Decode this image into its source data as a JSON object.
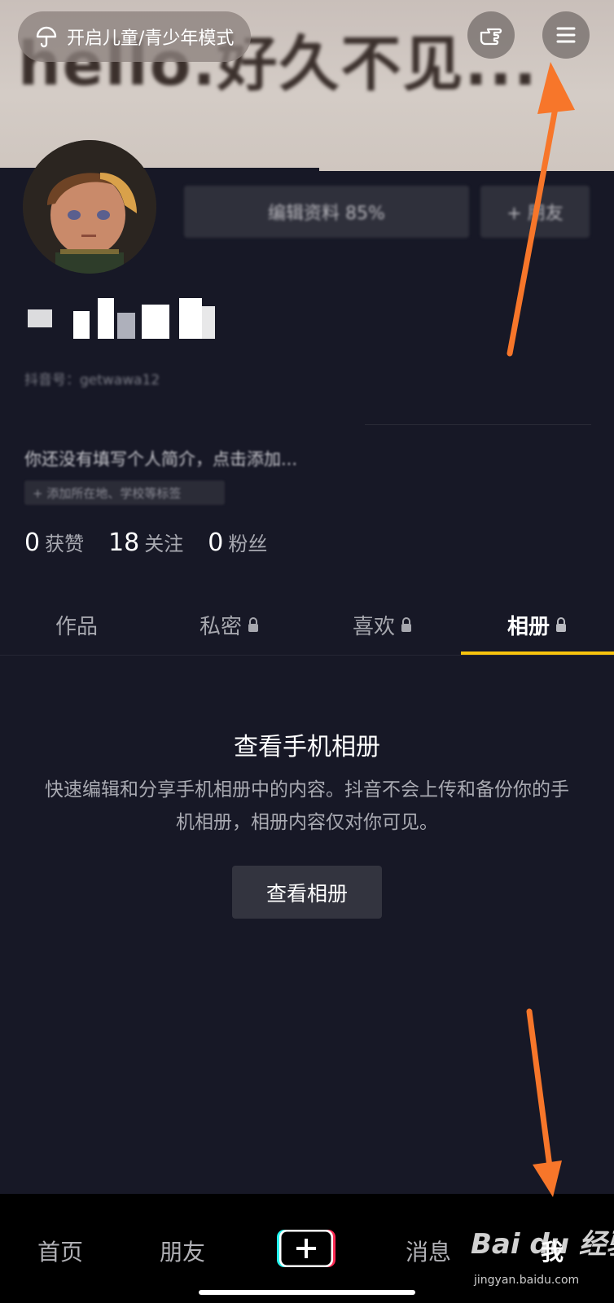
{
  "banner": {
    "background_text": "hello.好久不见...",
    "kids_mode_label": "开启儿童/青少年模式"
  },
  "profile": {
    "edit_profile_label": "编辑资料 85%",
    "add_friend_label": "+ 朋友",
    "douyin_id": "抖音号：getwawa12",
    "bio_placeholder": "你还没有填写个人简介，点击添加...",
    "tag_hint": "+ 添加所在地、学校等标签"
  },
  "stats": [
    {
      "num": "0",
      "label": "获赞"
    },
    {
      "num": "18",
      "label": "关注"
    },
    {
      "num": "0",
      "label": "粉丝"
    }
  ],
  "tabs": [
    {
      "label": "作品",
      "locked": false
    },
    {
      "label": "私密",
      "locked": true
    },
    {
      "label": "喜欢",
      "locked": true
    },
    {
      "label": "相册",
      "locked": true,
      "active": true
    }
  ],
  "album": {
    "title": "查看手机相册",
    "description": "快速编辑和分享手机相册中的内容。抖音不会上传和备份你的手机相册，相册内容仅对你可见。",
    "button_label": "查看相册"
  },
  "bottom_nav": {
    "home": "首页",
    "friends": "朋友",
    "messages": "消息",
    "me": "我"
  },
  "watermark": {
    "main": "Bai du 经验",
    "url": "jingyan.baidu.com"
  },
  "colors": {
    "background": "#171826",
    "tab_indicator": "#f7c30d",
    "annotation_arrow": "#f7762a",
    "bottom_nav": "#000000"
  },
  "icons": [
    "umbrella-icon",
    "pointing-hand-icon",
    "menu-icon",
    "lock-icon",
    "plus-icon"
  ]
}
